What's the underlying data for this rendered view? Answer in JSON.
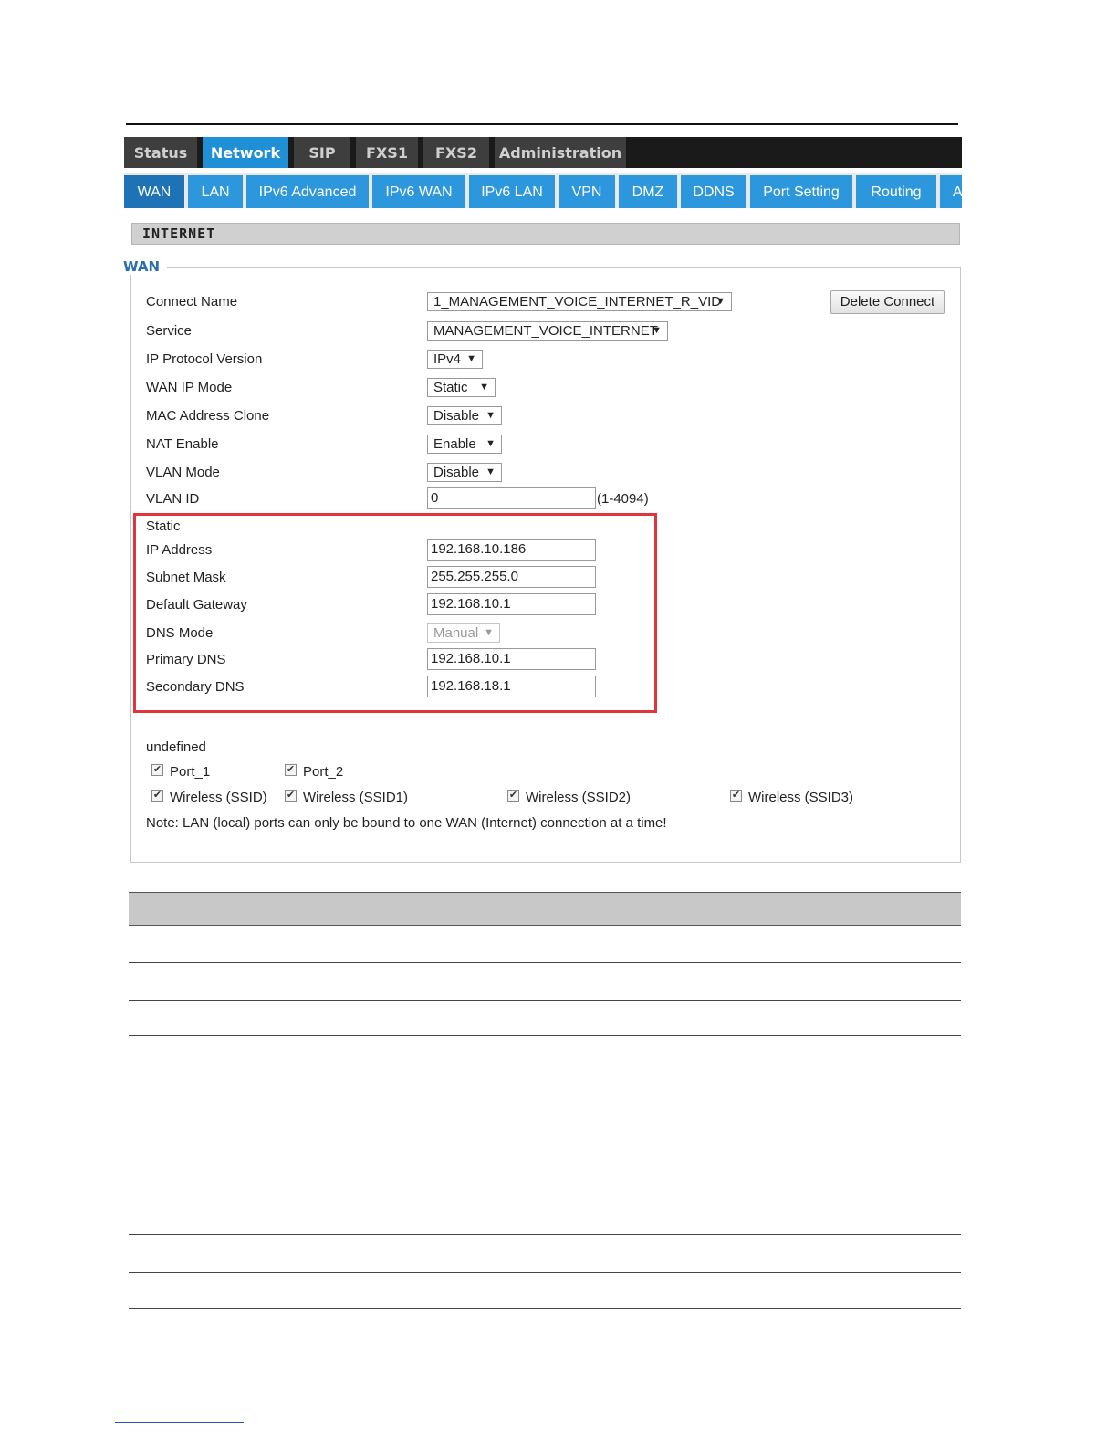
{
  "top_tabs": [
    "Status",
    "Network",
    "SIP",
    "FXS1",
    "FXS2",
    "Administration"
  ],
  "sub_tabs": [
    "WAN",
    "LAN",
    "IPv6 Advanced",
    "IPv6 WAN",
    "IPv6 LAN",
    "VPN",
    "DMZ",
    "DDNS",
    "Port Setting",
    "Routing",
    "A"
  ],
  "section": {
    "title": "INTERNET",
    "legend": "WAN"
  },
  "form": {
    "connect_name": {
      "label": "Connect Name",
      "value": "1_MANAGEMENT_VOICE_INTERNET_R_VID"
    },
    "delete_button": "Delete Connect",
    "service": {
      "label": "Service",
      "value": "MANAGEMENT_VOICE_INTERNET"
    },
    "ip_protocol": {
      "label": "IP Protocol Version",
      "value": "IPv4"
    },
    "wan_ip_mode": {
      "label": "WAN IP Mode",
      "value": "Static"
    },
    "mac_clone": {
      "label": "MAC Address Clone",
      "value": "Disable"
    },
    "nat_enable": {
      "label": "NAT Enable",
      "value": "Enable"
    },
    "vlan_mode": {
      "label": "VLAN Mode",
      "value": "Disable"
    },
    "vlan_id": {
      "label": "VLAN ID",
      "value": "0",
      "hint": "(1-4094)"
    }
  },
  "static": {
    "heading": "Static",
    "ip_address": {
      "label": "IP Address",
      "value": "192.168.10.186"
    },
    "subnet_mask": {
      "label": "Subnet Mask",
      "value": "255.255.255.0"
    },
    "default_gateway": {
      "label": "Default Gateway",
      "value": "192.168.10.1"
    },
    "dns_mode": {
      "label": "DNS Mode",
      "value": "Manual"
    },
    "primary_dns": {
      "label": "Primary DNS",
      "value": "192.168.10.1"
    },
    "secondary_dns": {
      "label": "Secondary DNS",
      "value": "192.168.18.1"
    }
  },
  "binding": {
    "heading": "undefined",
    "port_1": "Port_1",
    "port_2": "Port_2",
    "ssid": "Wireless (SSID)",
    "ssid1": "Wireless (SSID1)",
    "ssid2": "Wireless (SSID2)",
    "ssid3": "Wireless (SSID3)",
    "checked_glyph": "✔",
    "note": "Note: LAN (local) ports can only be bound to one WAN (Internet) connection at a time!"
  }
}
